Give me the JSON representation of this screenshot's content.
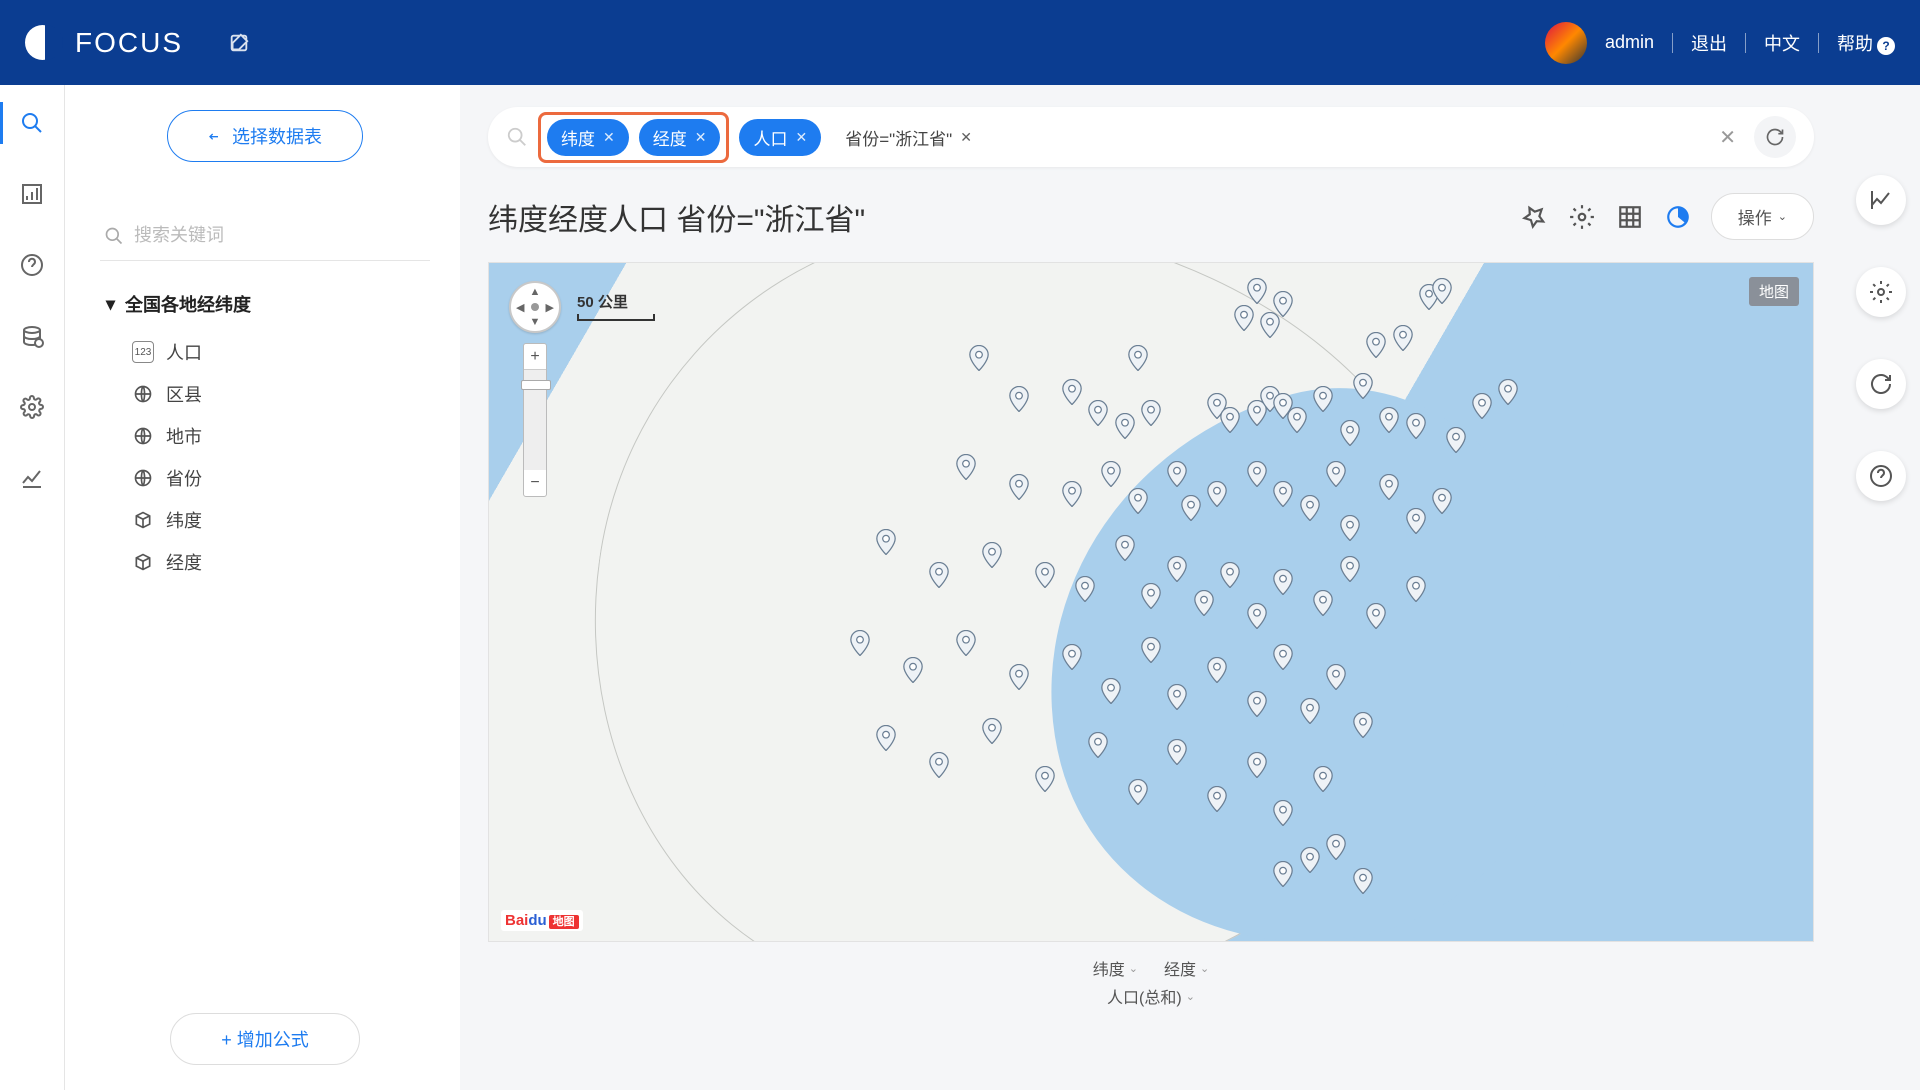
{
  "header": {
    "app_name": "FOCUS",
    "user": "admin",
    "logout": "退出",
    "language": "中文",
    "help": "帮助"
  },
  "sidebar": {
    "select_table_btn": "选择数据表",
    "search_placeholder": "搜索关键词",
    "tree_root": "全国各地经纬度",
    "fields": [
      {
        "icon": "123",
        "label": "人口"
      },
      {
        "icon": "globe",
        "label": "区县"
      },
      {
        "icon": "globe",
        "label": "地市"
      },
      {
        "icon": "globe",
        "label": "省份"
      },
      {
        "icon": "geo",
        "label": "纬度"
      },
      {
        "icon": "geo",
        "label": "经度"
      }
    ],
    "add_formula": "+ 增加公式"
  },
  "query": {
    "pills": [
      {
        "label": "纬度",
        "highlighted": true
      },
      {
        "label": "经度",
        "highlighted": true
      },
      {
        "label": "人口",
        "highlighted": false
      }
    ],
    "filter_text": "省份=\"浙江省\""
  },
  "title": "纬度经度人口 省份=\"浙江省\"",
  "ops_button": "操作",
  "map": {
    "scale_label": "50 公里",
    "type_badge": "地图",
    "attribution": "Baidu",
    "attribution_tag": "地图",
    "markers": [
      [
        58,
        6
      ],
      [
        60,
        8
      ],
      [
        57,
        10
      ],
      [
        59,
        11
      ],
      [
        71,
        7
      ],
      [
        72,
        6
      ],
      [
        67,
        14
      ],
      [
        69,
        13
      ],
      [
        37,
        16
      ],
      [
        40,
        22
      ],
      [
        44,
        21
      ],
      [
        49,
        16
      ],
      [
        46,
        24
      ],
      [
        48,
        26
      ],
      [
        50,
        24
      ],
      [
        55,
        23
      ],
      [
        56,
        25
      ],
      [
        58,
        24
      ],
      [
        59,
        22
      ],
      [
        60,
        23
      ],
      [
        61,
        25
      ],
      [
        63,
        22
      ],
      [
        65,
        27
      ],
      [
        66,
        20
      ],
      [
        68,
        25
      ],
      [
        70,
        26
      ],
      [
        73,
        28
      ],
      [
        75,
        23
      ],
      [
        77,
        21
      ],
      [
        36,
        32
      ],
      [
        40,
        35
      ],
      [
        44,
        36
      ],
      [
        47,
        33
      ],
      [
        49,
        37
      ],
      [
        52,
        33
      ],
      [
        53,
        38
      ],
      [
        55,
        36
      ],
      [
        58,
        33
      ],
      [
        60,
        36
      ],
      [
        62,
        38
      ],
      [
        64,
        33
      ],
      [
        65,
        41
      ],
      [
        68,
        35
      ],
      [
        70,
        40
      ],
      [
        72,
        37
      ],
      [
        30,
        43
      ],
      [
        34,
        48
      ],
      [
        38,
        45
      ],
      [
        42,
        48
      ],
      [
        45,
        50
      ],
      [
        48,
        44
      ],
      [
        50,
        51
      ],
      [
        52,
        47
      ],
      [
        54,
        52
      ],
      [
        56,
        48
      ],
      [
        58,
        54
      ],
      [
        60,
        49
      ],
      [
        63,
        52
      ],
      [
        65,
        47
      ],
      [
        67,
        54
      ],
      [
        70,
        50
      ],
      [
        28,
        58
      ],
      [
        32,
        62
      ],
      [
        36,
        58
      ],
      [
        40,
        63
      ],
      [
        44,
        60
      ],
      [
        47,
        65
      ],
      [
        50,
        59
      ],
      [
        52,
        66
      ],
      [
        55,
        62
      ],
      [
        58,
        67
      ],
      [
        60,
        60
      ],
      [
        62,
        68
      ],
      [
        64,
        63
      ],
      [
        66,
        70
      ],
      [
        30,
        72
      ],
      [
        34,
        76
      ],
      [
        38,
        71
      ],
      [
        42,
        78
      ],
      [
        46,
        73
      ],
      [
        49,
        80
      ],
      [
        52,
        74
      ],
      [
        55,
        81
      ],
      [
        58,
        76
      ],
      [
        60,
        83
      ],
      [
        63,
        78
      ],
      [
        62,
        90
      ],
      [
        64,
        88
      ],
      [
        66,
        93
      ],
      [
        60,
        92
      ]
    ]
  },
  "legend": {
    "row1": [
      {
        "label": "纬度"
      },
      {
        "label": "经度"
      }
    ],
    "row2": [
      {
        "label": "人口(总和)"
      }
    ]
  }
}
